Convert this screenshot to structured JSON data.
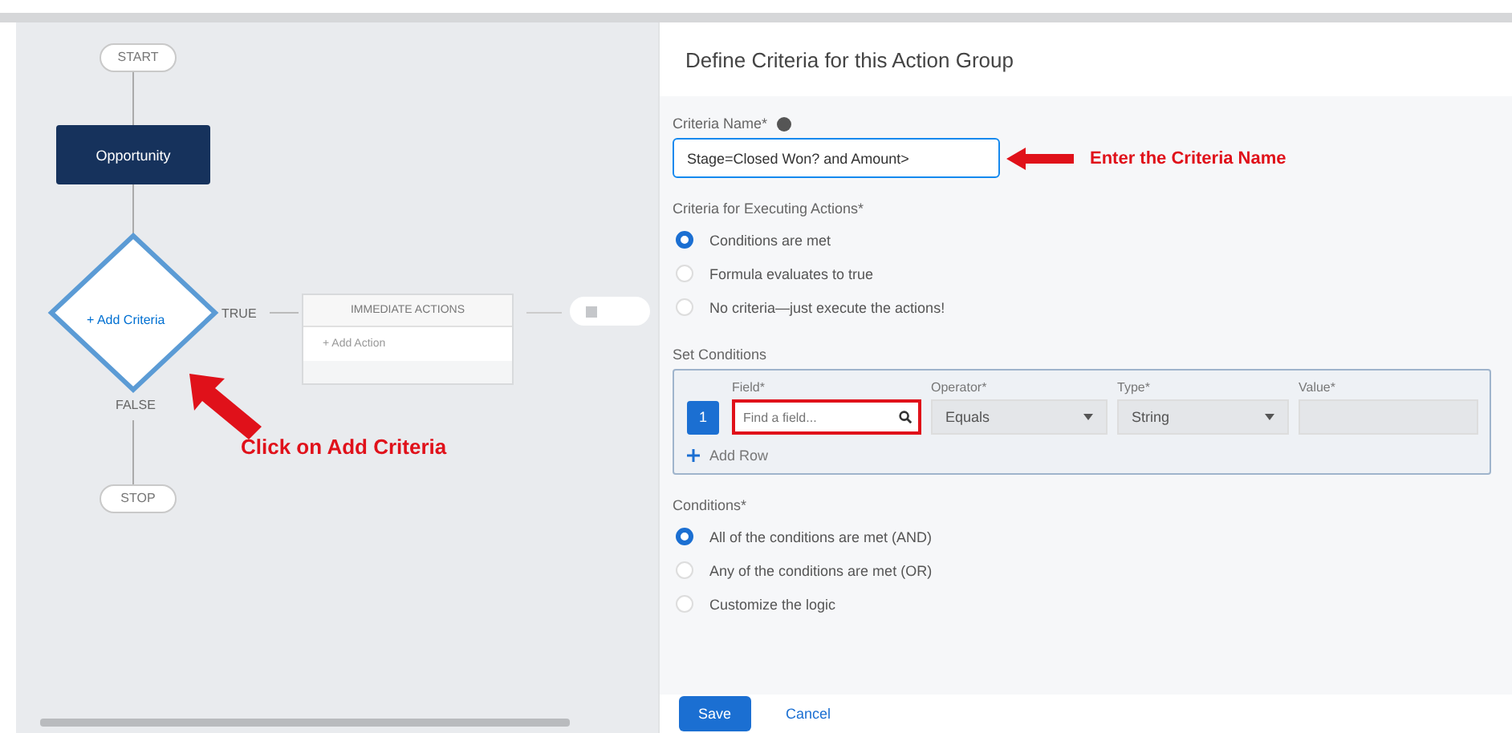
{
  "canvas": {
    "start": "START",
    "object": "Opportunity",
    "criteria": "+ Add Criteria",
    "true_label": "TRUE",
    "false_label": "FALSE",
    "immediate_actions": {
      "title": "IMMEDIATE ACTIONS",
      "add": "+ Add Action"
    },
    "stop": "STOP"
  },
  "canvas_annotation": "Click on Add Criteria",
  "panel": {
    "title": "Define Criteria for this Action Group",
    "criteria_name": {
      "label": "Criteria Name*",
      "value": "Stage=Closed Won? and Amount>"
    },
    "name_annotation": "Enter the Criteria Name",
    "executing": {
      "label": "Criteria for Executing Actions*",
      "options": [
        {
          "label": "Conditions are met",
          "selected": true
        },
        {
          "label": "Formula evaluates to true",
          "selected": false
        },
        {
          "label": "No criteria—just execute the actions!",
          "selected": false
        }
      ]
    },
    "set_conditions": {
      "label": "Set Conditions",
      "columns": [
        "Field*",
        "Operator*",
        "Type*",
        "Value*"
      ],
      "rows": [
        {
          "number": "1",
          "field_placeholder": "Find a field...",
          "operator": "Equals",
          "type": "String"
        }
      ],
      "add_row": "Add Row"
    },
    "conditions": {
      "label": "Conditions*",
      "options": [
        {
          "label": "All of the conditions are met (AND)",
          "selected": true
        },
        {
          "label": "Any of the conditions are met (OR)",
          "selected": false
        },
        {
          "label": "Customize the logic",
          "selected": false
        }
      ]
    },
    "buttons": [
      {
        "label": "Save",
        "kind": "primary"
      },
      {
        "label": "Cancel",
        "kind": "link"
      }
    ]
  }
}
